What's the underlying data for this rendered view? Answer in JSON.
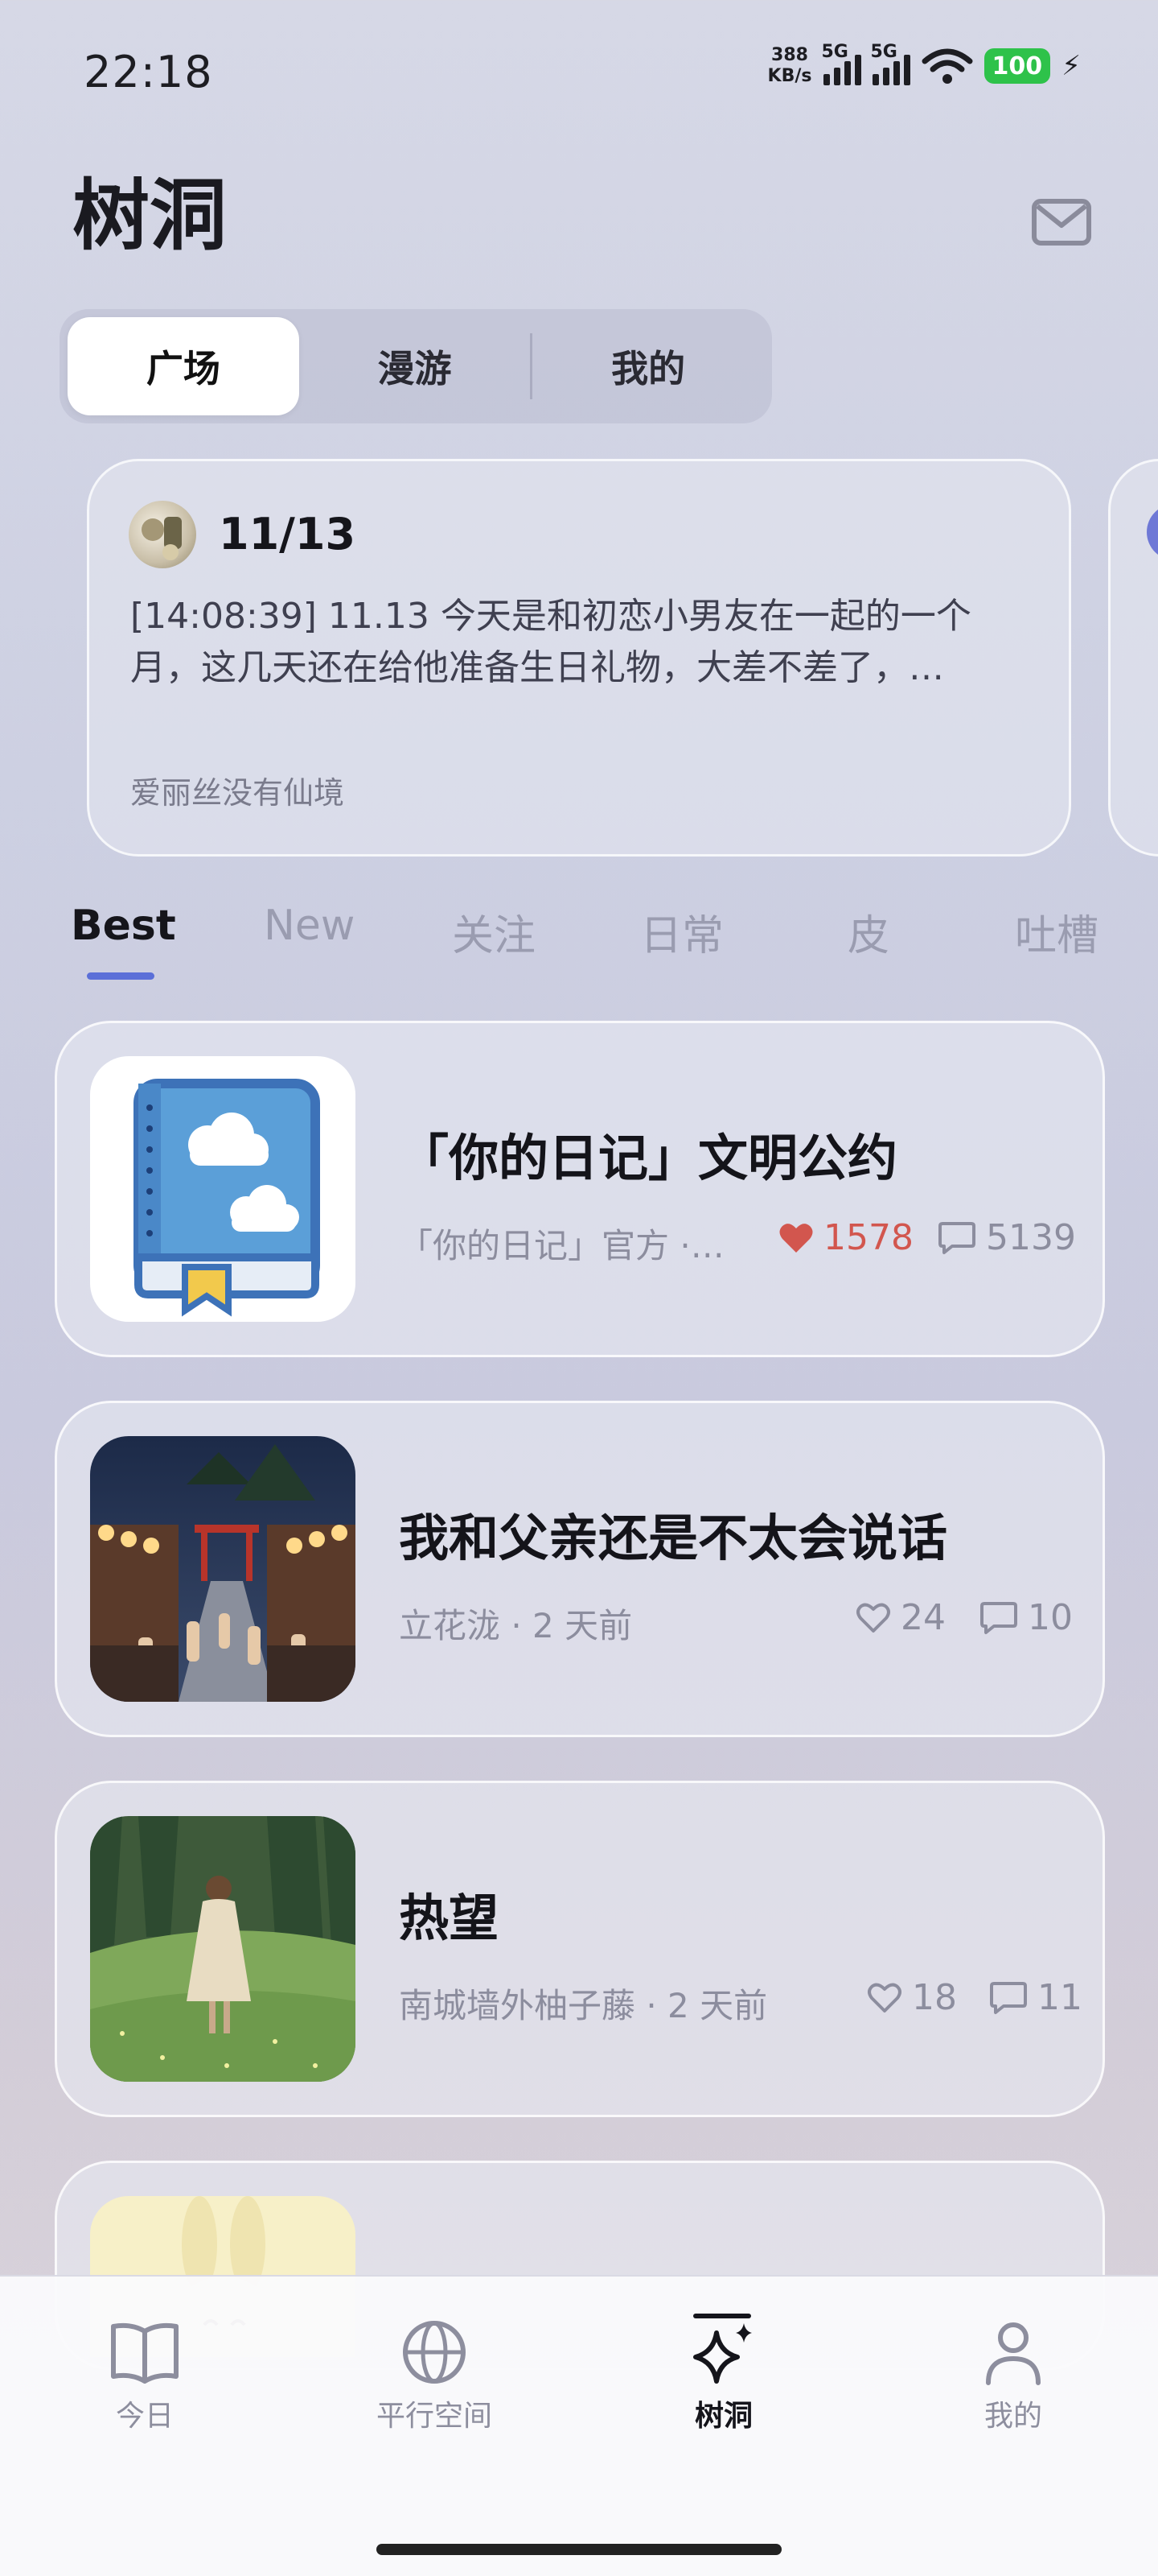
{
  "status_bar": {
    "time": "22:18",
    "net_speed_value": "388",
    "net_speed_unit": "KB/s",
    "signal_1_tag": "5G",
    "signal_2_tag": "5G",
    "battery": "100",
    "icons": [
      "signal-icon",
      "wifi-icon",
      "charging-icon"
    ]
  },
  "header": {
    "title": "树洞",
    "mail_icon": "mail-icon"
  },
  "segment": {
    "items": [
      {
        "label": "广场",
        "active": true
      },
      {
        "label": "漫游",
        "active": false
      },
      {
        "label": "我的",
        "active": false
      }
    ]
  },
  "featured": {
    "date": "11/13",
    "text_line1": "[14:08:39] 11.13 今天是和初恋小男友在一起的一个",
    "text_line2": "月，这几天还在给他准备生日礼物，大差不差了，…",
    "author": "爱丽丝没有仙境"
  },
  "category_tabs": [
    {
      "label": "Best",
      "active": true
    },
    {
      "label": "New",
      "active": false
    },
    {
      "label": "关注",
      "active": false
    },
    {
      "label": "日常",
      "active": false
    },
    {
      "label": "皮",
      "active": false
    },
    {
      "label": "吐槽",
      "active": false
    }
  ],
  "posts": [
    {
      "title": "「你的日记」文明公约",
      "meta": "「你的日记」官方 ·…",
      "likes": "1578",
      "comments": "5139",
      "liked": true,
      "thumb": "diary-book-icon"
    },
    {
      "title": "我和父亲还是不太会说话",
      "meta": "立花泷 · 2 天前",
      "likes": "24",
      "comments": "10",
      "liked": false,
      "thumb": "night-festival-street-image"
    },
    {
      "title": "热望",
      "meta": "南城墙外柚子藤 · 2 天前",
      "likes": "18",
      "comments": "11",
      "liked": false,
      "thumb": "girl-in-meadow-image"
    },
    {
      "thumb": "bunny-image"
    }
  ],
  "bottom_nav": [
    {
      "label": "今日",
      "icon": "book-open-icon",
      "active": false
    },
    {
      "label": "平行空间",
      "icon": "globe-icon",
      "active": false
    },
    {
      "label": "树洞",
      "icon": "sparkle-icon",
      "active": true
    },
    {
      "label": "我的",
      "icon": "person-icon",
      "active": false
    }
  ],
  "colors": {
    "accent": "#5b6fd8",
    "like_active": "#d2564e",
    "battery": "#2ec24a"
  }
}
